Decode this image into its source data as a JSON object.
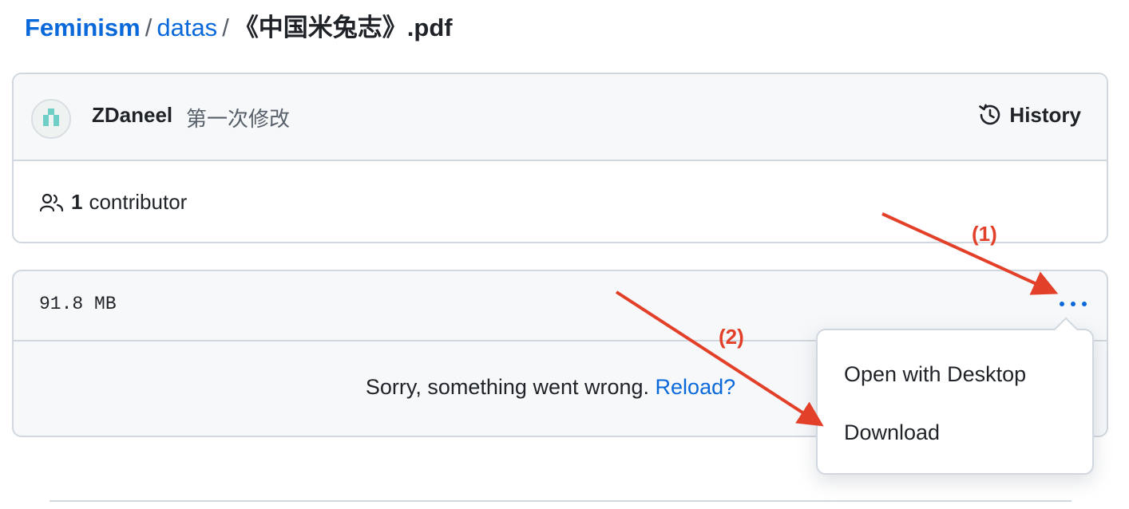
{
  "breadcrumb": {
    "repo": "Feminism",
    "sep1": "/",
    "dir": "datas",
    "sep2": "/",
    "file": "《中国米兔志》.pdf"
  },
  "commit": {
    "author": "ZDaneel",
    "message": "第一次修改",
    "history_label": "History",
    "contributor_count": "1",
    "contributor_label": "contributor"
  },
  "file": {
    "size": "91.8 MB",
    "error_message": "Sorry, something went wrong.",
    "reload_link": "Reload?"
  },
  "menu": {
    "items": [
      {
        "label": "Open with Desktop"
      },
      {
        "label": "Download"
      }
    ]
  },
  "annotations": {
    "step1": "(1)",
    "step2": "(2)",
    "color": "#e3402a"
  },
  "colors": {
    "link": "#0969da",
    "border": "#d0d7de",
    "header_bg": "#f6f8fa"
  },
  "icons": [
    "avatar-identicon",
    "history-icon",
    "people-icon",
    "kebab-icon"
  ]
}
